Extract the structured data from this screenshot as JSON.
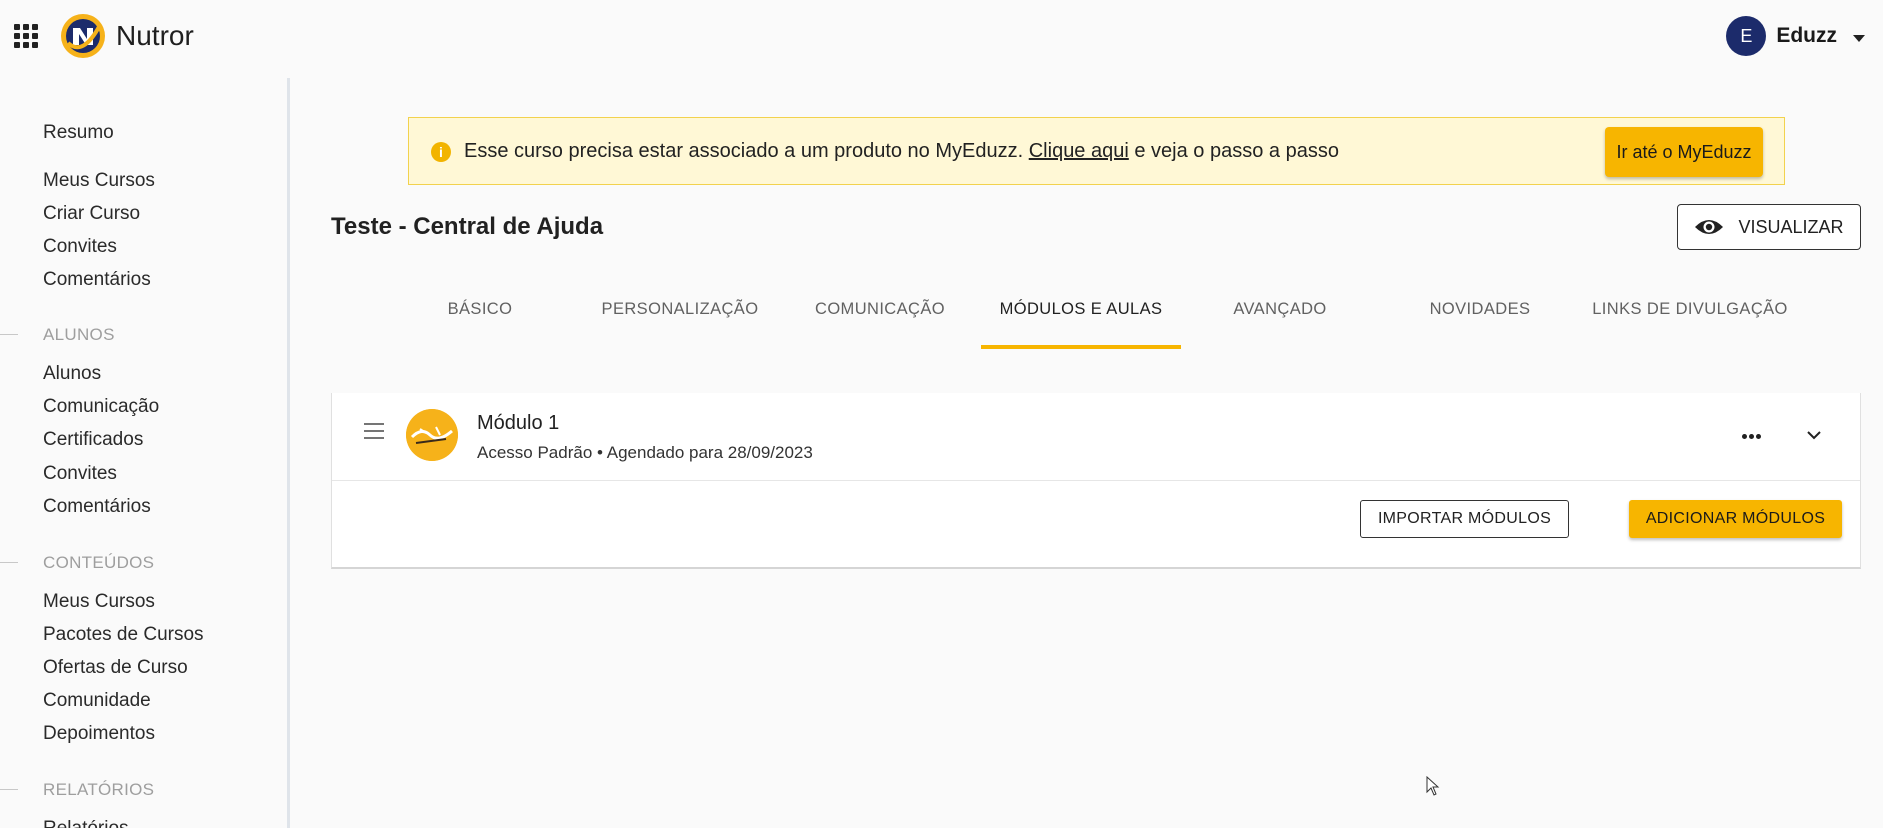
{
  "header": {
    "brand": "Nutror",
    "user": {
      "initial": "E",
      "name": "Eduzz"
    }
  },
  "sidebar": {
    "items_top": [
      "Resumo",
      "Meus Cursos",
      "Criar Curso",
      "Convites",
      "Comentários"
    ],
    "sections": [
      {
        "title": "ALUNOS",
        "items": [
          "Alunos",
          "Comunicação",
          "Certificados",
          "Convites",
          "Comentários"
        ]
      },
      {
        "title": "CONTEÚDOS",
        "items": [
          "Meus Cursos",
          "Pacotes de Cursos",
          "Ofertas de Curso",
          "Comunidade",
          "Depoimentos"
        ]
      },
      {
        "title": "RELATÓRIOS",
        "items": [
          "Relatórios"
        ]
      }
    ]
  },
  "alert": {
    "text_before": "Esse curso precisa estar associado a um produto no MyEduzz.",
    "link": "Clique aqui",
    "text_after": "e veja o passo a passo",
    "button": "Ir até o MyEduzz",
    "icon": "info-icon",
    "color": "#fff8d6"
  },
  "page": {
    "title": "Teste - Central de Ajuda",
    "view_button": "VISUALIZAR"
  },
  "tabs": [
    "BÁSICO",
    "PERSONALIZAÇÃO",
    "COMUNICAÇÃO",
    "MÓDULOS E AULAS",
    "AVANÇADO",
    "NOVIDADES",
    "LINKS DE DIVULGAÇÃO"
  ],
  "active_tab": "MÓDULOS E AULAS",
  "module": {
    "title": "Módulo 1",
    "subtitle": "Acesso Padrão • Agendado para 28/09/2023"
  },
  "actions": {
    "import": "IMPORTAR MÓDULOS",
    "add": "ADICIONAR MÓDULOS"
  },
  "colors": {
    "accent": "#f7b500",
    "avatar": "#1c2b6b"
  }
}
